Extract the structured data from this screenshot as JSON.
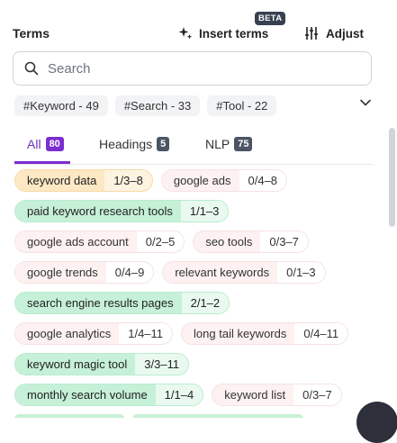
{
  "header": {
    "title": "Terms",
    "insert_label": "Insert terms",
    "beta_badge": "BETA",
    "adjust_label": "Adjust"
  },
  "search": {
    "placeholder": "Search"
  },
  "filters": [
    "#Keyword - 49",
    "#Search - 33",
    "#Tool - 22"
  ],
  "tabs": [
    {
      "label": "All",
      "count": "80",
      "active": true
    },
    {
      "label": "Headings",
      "count": "5",
      "active": false
    },
    {
      "label": "NLP",
      "count": "75",
      "active": false
    }
  ],
  "terms": [
    [
      {
        "label": "keyword data",
        "count": "1/3–8",
        "color": "orange"
      },
      {
        "label": "google ads",
        "count": "0/4–8",
        "color": "red"
      }
    ],
    [
      {
        "label": "paid keyword research tools",
        "count": "1/1–3",
        "color": "green"
      }
    ],
    [
      {
        "label": "google ads account",
        "count": "0/2–5",
        "color": "red"
      },
      {
        "label": "seo tools",
        "count": "0/3–7",
        "color": "red"
      }
    ],
    [
      {
        "label": "google trends",
        "count": "0/4–9",
        "color": "red"
      },
      {
        "label": "relevant keywords",
        "count": "0/1–3",
        "color": "red"
      }
    ],
    [
      {
        "label": "search engine results pages",
        "count": "2/1–2",
        "color": "green"
      }
    ],
    [
      {
        "label": "google analytics",
        "count": "1/4–11",
        "color": "red"
      },
      {
        "label": "long tail keywords",
        "count": "0/4–11",
        "color": "red"
      }
    ],
    [
      {
        "label": "keyword magic tool",
        "count": "3/3–11",
        "color": "green"
      }
    ],
    [
      {
        "label": "monthly search volume",
        "count": "1/1–4",
        "color": "green"
      },
      {
        "label": "keyword list",
        "count": "0/3–7",
        "color": "red"
      }
    ]
  ],
  "colors": {
    "accent": "#7b2fd0",
    "green_bg": "#c6f0d7",
    "orange_bg": "#fde8c4",
    "red_bg": "#fdf1f1"
  },
  "icons": {
    "insert": "sparkle-icon",
    "adjust": "sliders-icon",
    "search": "search-icon",
    "expand": "chevron-down-icon"
  }
}
